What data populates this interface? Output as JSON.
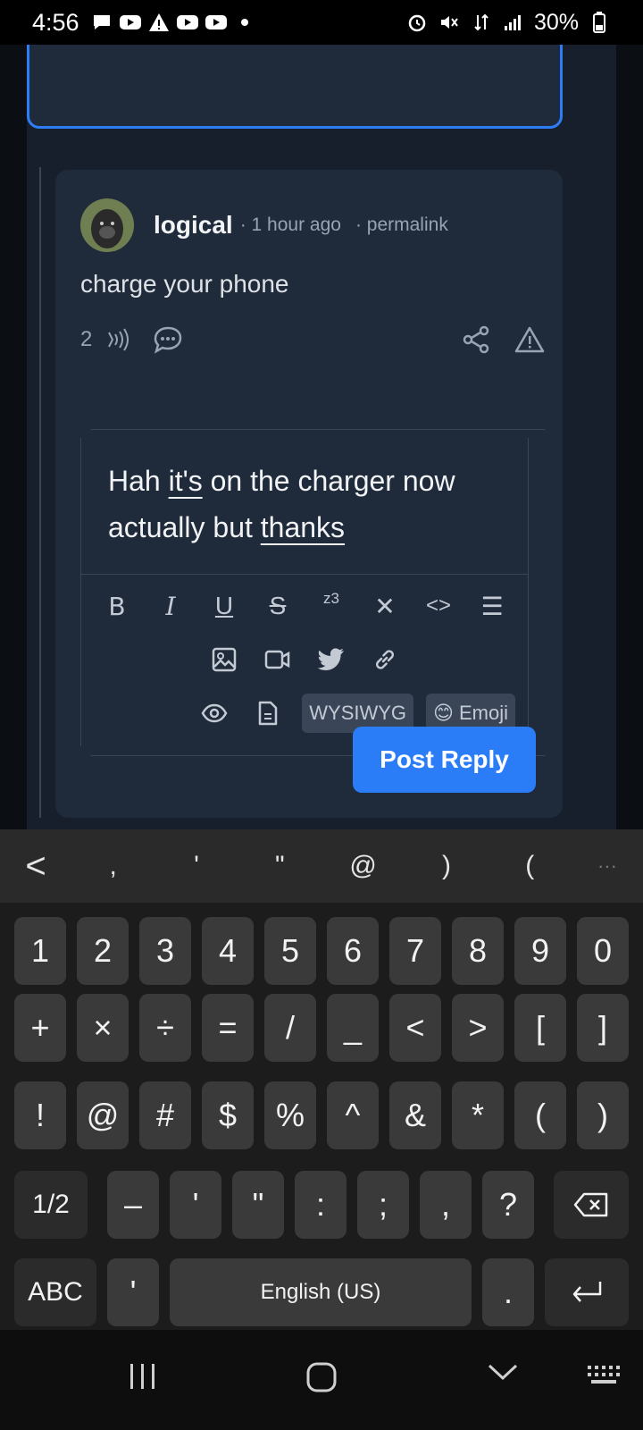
{
  "status_bar": {
    "time": "4:56",
    "battery": "30%",
    "notification_icons": [
      "chat-icon",
      "youtube-icon",
      "warning-icon",
      "youtube-icon",
      "youtube-icon",
      "dot-icon"
    ],
    "system_icons": [
      "alarm-icon",
      "mute-icon",
      "data-icon",
      "signal-icon",
      "battery-icon"
    ]
  },
  "comment": {
    "author": "logical",
    "time": "· 1 hour ago",
    "permalink": "· permalink",
    "body": "charge your phone",
    "score": "2"
  },
  "editor": {
    "text_parts": [
      "Hah ",
      "it's",
      " on the charger now actually but ",
      "thanks"
    ],
    "toolbar_row1": [
      {
        "name": "bold-button",
        "glyph": "B"
      },
      {
        "name": "italic-button",
        "glyph": "I"
      },
      {
        "name": "underline-button",
        "glyph": "U"
      },
      {
        "name": "strikethrough-button",
        "glyph": "S"
      },
      {
        "name": "superscript-button",
        "glyph": "z3"
      },
      {
        "name": "clear-format-button",
        "glyph": "✕"
      },
      {
        "name": "code-button",
        "glyph": "<>"
      },
      {
        "name": "list-button",
        "glyph": "☰"
      }
    ],
    "wysiwyg_label": "WYSIWYG",
    "emoji_label": "Emoji",
    "emoji_glyph": "😊"
  },
  "post_reply_label": "Post Reply",
  "keyboard": {
    "toolbar": [
      "<",
      ",",
      "'",
      "\"",
      "@",
      ")",
      "(",
      "···"
    ],
    "row1": [
      "1",
      "2",
      "3",
      "4",
      "5",
      "6",
      "7",
      "8",
      "9",
      "0"
    ],
    "row2": [
      "+",
      "×",
      "÷",
      "=",
      "/",
      "_",
      "<",
      ">",
      "[",
      "]"
    ],
    "row3": [
      "!",
      "@",
      "#",
      "$",
      "%",
      "^",
      "&",
      "*",
      "(",
      ")"
    ],
    "row4": [
      "1/2",
      "–",
      "'",
      "\"",
      ":",
      ";",
      ",",
      "?"
    ],
    "abc_label": "ABC",
    "apostrophe": "'",
    "space_label": "English (US)",
    "period": "."
  },
  "colors": {
    "accent": "#2b7df7",
    "card": "#1f2a3b",
    "background": "#171f2c"
  }
}
